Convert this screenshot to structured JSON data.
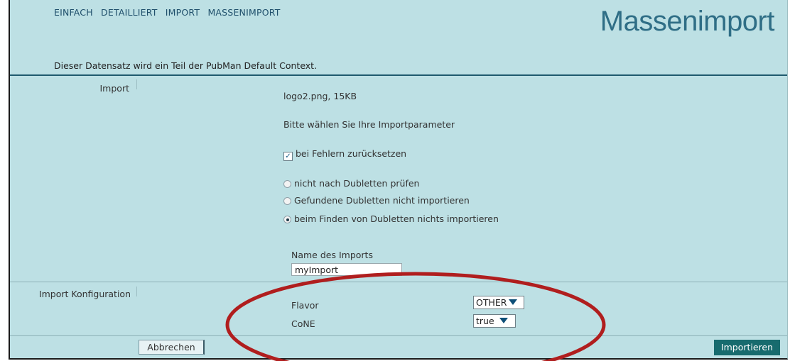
{
  "nav": {
    "items": [
      "EINFACH",
      "DETAILLIERT",
      "IMPORT",
      "MASSENIMPORT"
    ]
  },
  "page_title": "Massenimport",
  "context_text": "Dieser Datensatz wird ein Teil der PubMan Default Context.",
  "import_section": {
    "label": "Import",
    "file_info": "logo2.png, 15KB",
    "params_prompt": "Bitte wählen Sie Ihre Importparameter",
    "rollback_checkbox": {
      "label": "bei Fehlern zurücksetzen",
      "checked": true
    },
    "duplicate_options": [
      {
        "label": "nicht nach Dubletten prüfen",
        "selected": false
      },
      {
        "label": "Gefundene Dubletten nicht importieren",
        "selected": false
      },
      {
        "label": "beim Finden von Dubletten nichts importieren",
        "selected": true
      }
    ],
    "name_label": "Name des Imports",
    "name_value": "myImport"
  },
  "config_section": {
    "label": "Import Konfiguration",
    "flavor_label": "Flavor",
    "flavor_value": "OTHER",
    "cone_label": "CoNE",
    "cone_value": "true"
  },
  "buttons": {
    "cancel": "Abbrechen",
    "import": "Importieren"
  },
  "colors": {
    "background": "#bde0e4",
    "title": "#2f6e86",
    "import_button": "#176b6e",
    "annotation_ellipse": "#b01e1e"
  }
}
